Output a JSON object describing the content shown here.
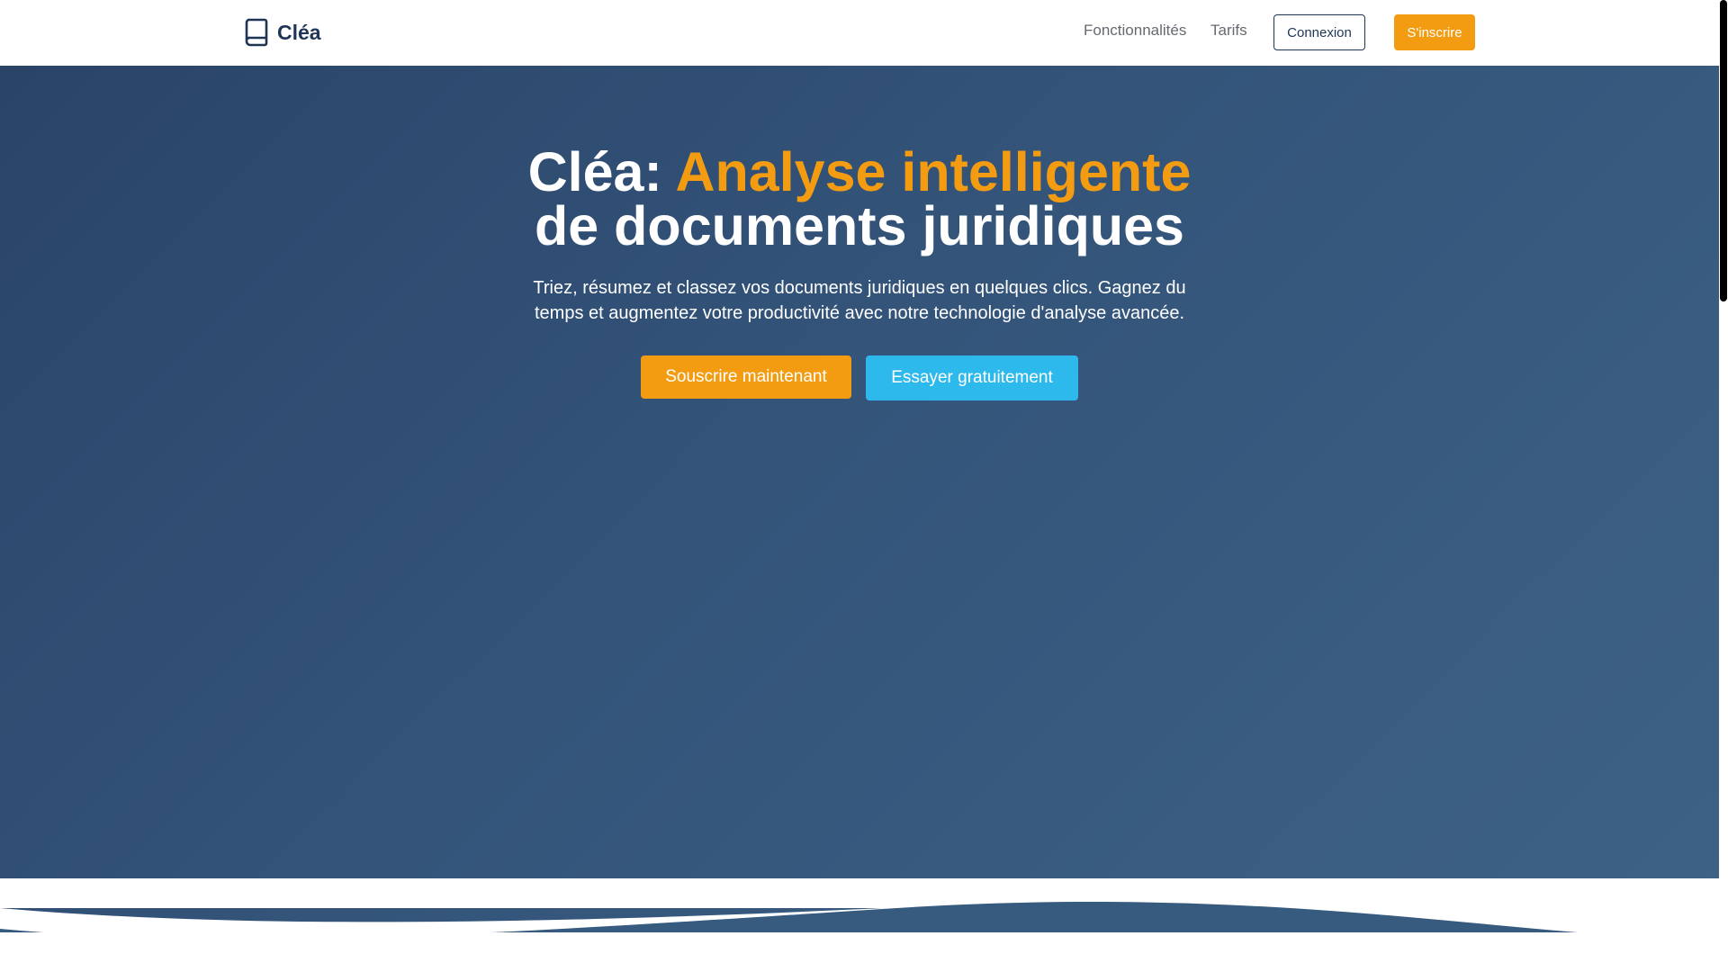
{
  "navbar": {
    "brand": {
      "name": "Cléa",
      "icon": "book-icon"
    },
    "links": [
      {
        "label": "Fonctionnalités"
      },
      {
        "label": "Tarifs"
      }
    ],
    "login_label": "Connexion",
    "signup_label": "S'inscrire"
  },
  "hero": {
    "title_prefix": "Cléa: ",
    "title_accent": "Analyse intelligente",
    "title_rest": "de documents juridiques",
    "subtitle": "Triez, résumez et classez vos documents juridiques en quelques clics. Gagnez du temps et augmentez votre productivité avec notre technologie d'analyse avancée.",
    "cta_primary": "Souscrire maintenant",
    "cta_secondary": "Essayer gratuitement"
  },
  "colors": {
    "brand_navy": "#1e3556",
    "accent_orange": "#f39c12",
    "accent_cyan": "#2db9ec",
    "hero_start": "#2a4468",
    "hero_end": "#3d6285"
  }
}
